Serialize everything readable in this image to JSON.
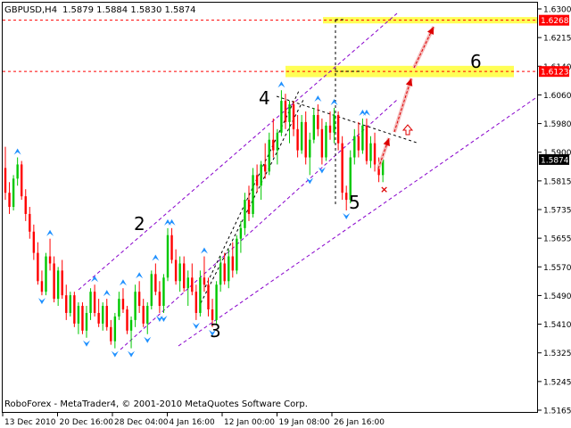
{
  "header": {
    "symbol_tf": "GBPUSD,H4",
    "ohlc": "1.5879 1.5884 1.5830 1.5874"
  },
  "footer": {
    "copyright": "RoboForex - MetaTrader4, © 2001-2010 MetaQuotes Software Corp."
  },
  "chart_data": {
    "type": "candlestick",
    "y_ticks": [
      "1.6300",
      "1.6215",
      "1.6140",
      "1.6060",
      "1.5980",
      "1.5900",
      "1.5815",
      "1.5735",
      "1.5655",
      "1.5570",
      "1.5490",
      "1.5410",
      "1.5325",
      "1.5245",
      "1.5165"
    ],
    "x_ticks": [
      "13 Dec 2010",
      "20 Dec 16:00",
      "28 Dec 04:00",
      "4 Jan 16:00",
      "12 Jan 00:00",
      "19 Jan 08:00",
      "26 Jan 16:00"
    ],
    "price_labels": [
      {
        "text": "1.6268",
        "value": 1.6268,
        "color": "#ff0000"
      },
      {
        "text": "1.6123",
        "value": 1.6123,
        "color": "#ff0000"
      },
      {
        "text": "1.5874",
        "value": 1.5874,
        "color": "#000000"
      }
    ],
    "target_zones": [
      {
        "low": 1.6259,
        "high": 1.6277
      },
      {
        "low": 1.6107,
        "high": 1.6139
      }
    ],
    "wave_labels": [
      "2",
      "3",
      "4",
      "5",
      "6"
    ],
    "colors": {
      "bull": "#00c800",
      "bear": "#ff0000",
      "channel": "#8800cc",
      "fractal": "#1e90ff",
      "zone": "#ffff55",
      "arrow": "#dd0000"
    },
    "candles": [
      [
        1.585,
        1.591,
        1.576,
        1.578
      ],
      [
        1.578,
        1.581,
        1.572,
        1.574
      ],
      [
        1.574,
        1.583,
        1.573,
        1.582
      ],
      [
        1.582,
        1.588,
        1.58,
        1.586
      ],
      [
        1.586,
        1.587,
        1.576,
        1.577
      ],
      [
        1.577,
        1.579,
        1.57,
        1.572
      ],
      [
        1.572,
        1.574,
        1.565,
        1.567
      ],
      [
        1.567,
        1.569,
        1.559,
        1.561
      ],
      [
        1.561,
        1.564,
        1.552,
        1.553
      ],
      [
        1.553,
        1.556,
        1.549,
        1.55
      ],
      [
        1.55,
        1.561,
        1.549,
        1.56
      ],
      [
        1.56,
        1.565,
        1.556,
        1.558
      ],
      [
        1.558,
        1.56,
        1.547,
        1.548
      ],
      [
        1.548,
        1.557,
        1.546,
        1.556
      ],
      [
        1.556,
        1.559,
        1.548,
        1.549
      ],
      [
        1.549,
        1.552,
        1.542,
        1.544
      ],
      [
        1.544,
        1.55,
        1.543,
        1.549
      ],
      [
        1.549,
        1.55,
        1.54,
        1.541
      ],
      [
        1.541,
        1.547,
        1.538,
        1.546
      ],
      [
        1.546,
        1.547,
        1.538,
        1.539
      ],
      [
        1.539,
        1.546,
        1.537,
        1.544
      ],
      [
        1.544,
        1.551,
        1.542,
        1.55
      ],
      [
        1.55,
        1.552,
        1.543,
        1.544
      ],
      [
        1.544,
        1.548,
        1.54,
        1.541
      ],
      [
        1.541,
        1.547,
        1.539,
        1.546
      ],
      [
        1.546,
        1.548,
        1.539,
        1.54
      ],
      [
        1.54,
        1.542,
        1.535,
        1.536
      ],
      [
        1.536,
        1.544,
        1.534,
        1.543
      ],
      [
        1.543,
        1.55,
        1.542,
        1.548
      ],
      [
        1.548,
        1.551,
        1.544,
        1.545
      ],
      [
        1.545,
        1.546,
        1.538,
        1.539
      ],
      [
        1.539,
        1.543,
        1.534,
        1.542
      ],
      [
        1.542,
        1.552,
        1.54,
        1.55
      ],
      [
        1.55,
        1.553,
        1.544,
        1.546
      ],
      [
        1.546,
        1.548,
        1.54,
        1.541
      ],
      [
        1.541,
        1.547,
        1.538,
        1.546
      ],
      [
        1.546,
        1.556,
        1.545,
        1.555
      ],
      [
        1.555,
        1.558,
        1.549,
        1.55
      ],
      [
        1.55,
        1.553,
        1.544,
        1.546
      ],
      [
        1.546,
        1.555,
        1.544,
        1.554
      ],
      [
        1.554,
        1.568,
        1.553,
        1.566
      ],
      [
        1.566,
        1.568,
        1.558,
        1.559
      ],
      [
        1.559,
        1.562,
        1.552,
        1.553
      ],
      [
        1.553,
        1.56,
        1.55,
        1.558
      ],
      [
        1.558,
        1.56,
        1.55,
        1.551
      ],
      [
        1.551,
        1.556,
        1.546,
        1.554
      ],
      [
        1.554,
        1.558,
        1.549,
        1.55
      ],
      [
        1.55,
        1.552,
        1.542,
        1.544
      ],
      [
        1.544,
        1.556,
        1.543,
        1.554
      ],
      [
        1.554,
        1.56,
        1.55,
        1.552
      ],
      [
        1.552,
        1.554,
        1.543,
        1.545
      ],
      [
        1.545,
        1.548,
        1.54,
        1.542
      ],
      [
        1.542,
        1.553,
        1.541,
        1.552
      ],
      [
        1.552,
        1.56,
        1.55,
        1.558
      ],
      [
        1.558,
        1.561,
        1.552,
        1.553
      ],
      [
        1.553,
        1.562,
        1.551,
        1.56
      ],
      [
        1.56,
        1.564,
        1.554,
        1.556
      ],
      [
        1.556,
        1.566,
        1.555,
        1.565
      ],
      [
        1.565,
        1.57,
        1.561,
        1.568
      ],
      [
        1.568,
        1.578,
        1.566,
        1.576
      ],
      [
        1.576,
        1.58,
        1.57,
        1.572
      ],
      [
        1.572,
        1.585,
        1.571,
        1.583
      ],
      [
        1.583,
        1.586,
        1.578,
        1.58
      ],
      [
        1.58,
        1.587,
        1.576,
        1.586
      ],
      [
        1.586,
        1.592,
        1.582,
        1.584
      ],
      [
        1.584,
        1.595,
        1.583,
        1.593
      ],
      [
        1.593,
        1.599,
        1.588,
        1.59
      ],
      [
        1.59,
        1.596,
        1.586,
        1.595
      ],
      [
        1.595,
        1.607,
        1.594,
        1.604
      ],
      [
        1.604,
        1.606,
        1.596,
        1.598
      ],
      [
        1.598,
        1.604,
        1.592,
        1.603
      ],
      [
        1.603,
        1.604,
        1.594,
        1.596
      ],
      [
        1.596,
        1.6,
        1.588,
        1.59
      ],
      [
        1.59,
        1.6,
        1.589,
        1.598
      ],
      [
        1.598,
        1.601,
        1.586,
        1.588
      ],
      [
        1.588,
        1.595,
        1.583,
        1.593
      ],
      [
        1.593,
        1.602,
        1.592,
        1.6
      ],
      [
        1.6,
        1.603,
        1.594,
        1.596
      ],
      [
        1.596,
        1.599,
        1.586,
        1.588
      ],
      [
        1.588,
        1.598,
        1.587,
        1.597
      ],
      [
        1.597,
        1.601,
        1.593,
        1.595
      ],
      [
        1.595,
        1.602,
        1.592,
        1.6
      ],
      [
        1.6,
        1.601,
        1.59,
        1.592
      ],
      [
        1.592,
        1.594,
        1.576,
        1.578
      ],
      [
        1.578,
        1.58,
        1.573,
        1.576
      ],
      [
        1.576,
        1.59,
        1.575,
        1.588
      ],
      [
        1.588,
        1.596,
        1.586,
        1.594
      ],
      [
        1.594,
        1.598,
        1.588,
        1.59
      ],
      [
        1.59,
        1.599,
        1.589,
        1.597
      ],
      [
        1.597,
        1.599,
        1.586,
        1.587
      ],
      [
        1.587,
        1.594,
        1.585,
        1.592
      ],
      [
        1.592,
        1.595,
        1.584,
        1.586
      ],
      [
        1.586,
        1.588,
        1.581,
        1.583
      ],
      [
        1.583,
        1.589,
        1.581,
        1.5874
      ]
    ]
  }
}
